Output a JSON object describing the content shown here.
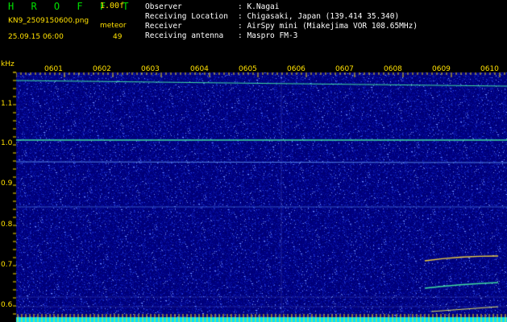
{
  "header": {
    "app_title": "H R O F F T",
    "version": "1.00f",
    "filename": "KN9_2509150600.png",
    "mode": "meteor",
    "datetime": "25.09.15 06:00",
    "count": "49"
  },
  "info": [
    {
      "key": "Observer",
      "value": ": K.Nagai"
    },
    {
      "key": "Receiving Location",
      "value": ": Chigasaki, Japan (139.414 35.340)"
    },
    {
      "key": "Receiver",
      "value": ": AirSpy mini (Miakejima VOR 108.65MHz)"
    },
    {
      "key": "Receiving antenna",
      "value": ": Maspro FM-3"
    }
  ],
  "axis": {
    "y_unit": "kHz",
    "y_ticks": [
      "1.1",
      "1.0",
      "0.9",
      "0.8",
      "0.7",
      "0.6"
    ],
    "x_ticks": [
      "0601",
      "0602",
      "0603",
      "0604",
      "0605",
      "0606",
      "0607",
      "0608",
      "0609",
      "0610"
    ]
  },
  "colors": {
    "background": "#00008a",
    "carrier": "#40e0a0",
    "tick": "#ffe000",
    "bottom_band": "#00e0ff"
  }
}
